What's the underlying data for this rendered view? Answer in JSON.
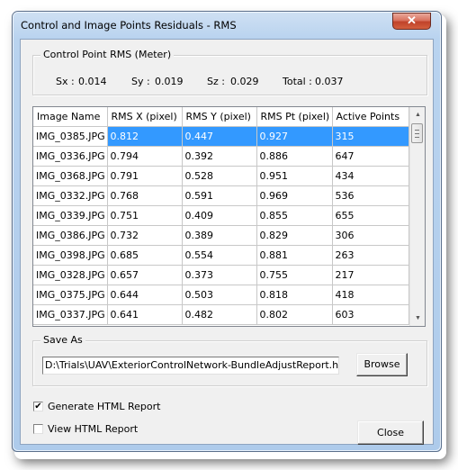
{
  "window": {
    "title": "Control and Image Points Residuals - RMS",
    "close_glyph": "✕"
  },
  "control_point_rms": {
    "legend": "Control Point RMS (Meter)",
    "sx_label": "Sx :",
    "sx_value": "0.014",
    "sy_label": "Sy :",
    "sy_value": "0.019",
    "sz_label": "Sz :",
    "sz_value": "0.029",
    "total_label": "Total :",
    "total_value": "0.037"
  },
  "table": {
    "columns": [
      "Image Name",
      "RMS X (pixel)",
      "RMS Y (pixel)",
      "RMS Pt (pixel)",
      "Active Points"
    ],
    "rows": [
      [
        "IMG_0385.JPG",
        "0.812",
        "0.447",
        "0.927",
        "315"
      ],
      [
        "IMG_0336.JPG",
        "0.794",
        "0.392",
        "0.886",
        "647"
      ],
      [
        "IMG_0368.JPG",
        "0.791",
        "0.528",
        "0.951",
        "434"
      ],
      [
        "IMG_0332.JPG",
        "0.768",
        "0.591",
        "0.969",
        "536"
      ],
      [
        "IMG_0339.JPG",
        "0.751",
        "0.409",
        "0.855",
        "655"
      ],
      [
        "IMG_0386.JPG",
        "0.732",
        "0.389",
        "0.829",
        "306"
      ],
      [
        "IMG_0398.JPG",
        "0.685",
        "0.554",
        "0.881",
        "263"
      ],
      [
        "IMG_0328.JPG",
        "0.657",
        "0.373",
        "0.755",
        "217"
      ],
      [
        "IMG_0375.JPG",
        "0.644",
        "0.503",
        "0.818",
        "418"
      ],
      [
        "IMG_0337.JPG",
        "0.641",
        "0.482",
        "0.802",
        "603"
      ]
    ],
    "selected_row": 0,
    "selection_color": "#3399ff",
    "scroll_up_glyph": "▲",
    "scroll_down_glyph": "▼"
  },
  "save_as": {
    "legend": "Save As",
    "path_value": "D:\\Trials\\UAV\\ExteriorControlNetwork-BundleAdjustReport.htm",
    "browse_label": "Browse"
  },
  "options": {
    "generate_html_label": "Generate HTML Report",
    "generate_html_checked": true,
    "view_html_label": "View HTML Report",
    "view_html_checked": false,
    "check_glyph": "✔"
  },
  "footer": {
    "close_label": "Close"
  }
}
